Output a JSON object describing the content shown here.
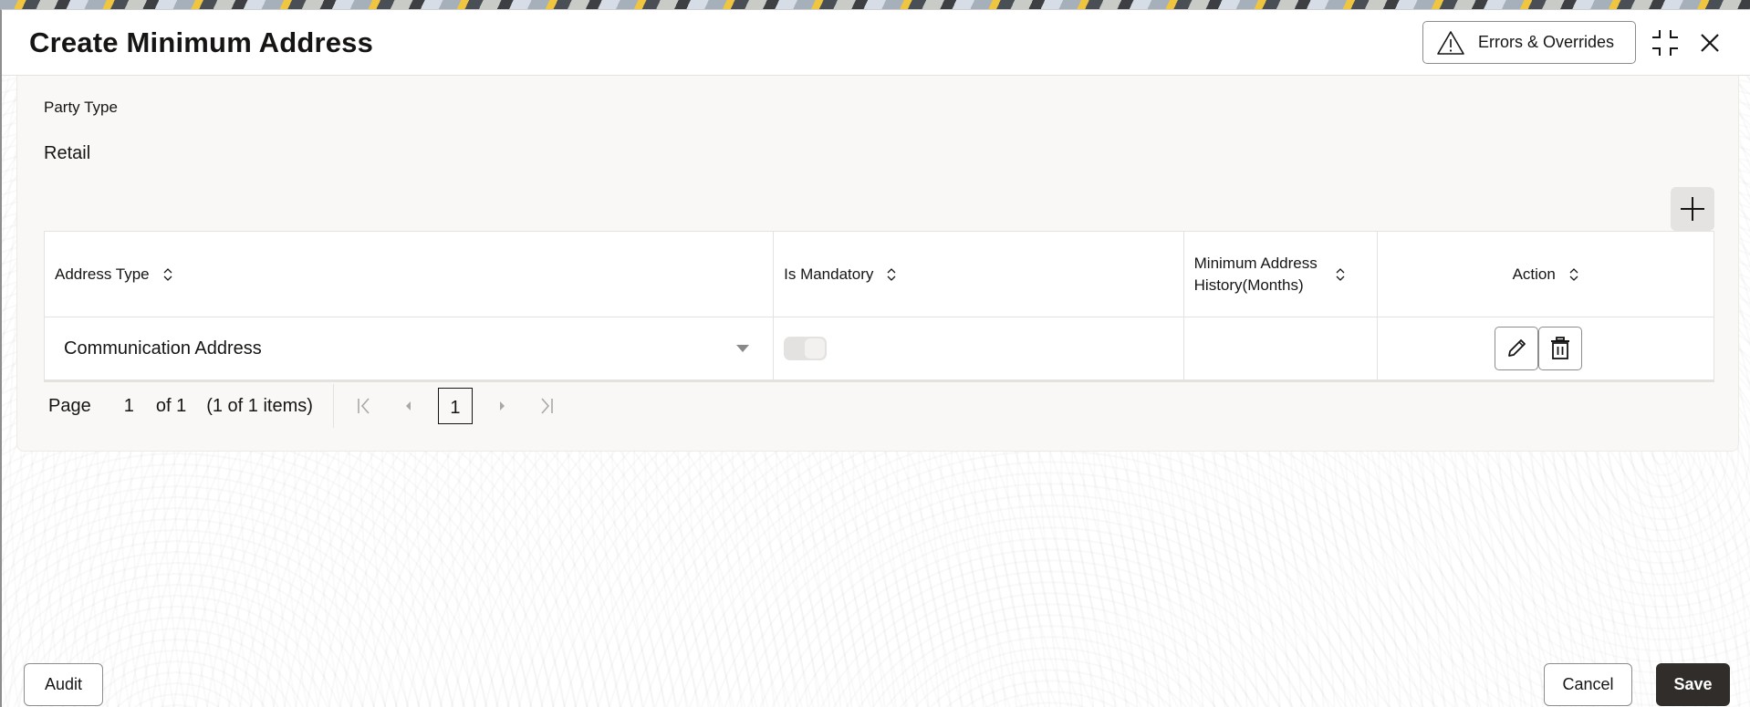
{
  "dialog": {
    "title": "Create Minimum Address",
    "errors_button_label": "Errors & Overrides",
    "icons": {
      "errors": "warning-triangle-icon",
      "compress": "compress-icon",
      "close": "close-icon"
    }
  },
  "form": {
    "party_type_label": "Party Type",
    "party_type_value": "Retail",
    "add_row_icon": "plus-icon"
  },
  "table": {
    "columns": [
      {
        "label": "Address Type",
        "sortable": true
      },
      {
        "label": "Is Mandatory",
        "sortable": true
      },
      {
        "label": "Minimum Address History(Months)",
        "sortable": true
      },
      {
        "label": "Action",
        "sortable": true
      }
    ],
    "rows": [
      {
        "address_type": "Communication Address",
        "is_mandatory": false,
        "min_history_months": "",
        "actions": [
          "edit",
          "delete"
        ]
      }
    ]
  },
  "pagination": {
    "page_label": "Page",
    "current_page": "1",
    "of_label": "of 1",
    "items_summary": "(1 of 1 items)",
    "page_buttons": [
      "1"
    ]
  },
  "footer": {
    "audit_label": "Audit",
    "cancel_label": "Cancel",
    "save_label": "Save"
  },
  "colors": {
    "primary_button": "#312d2a",
    "panel_background": "#f9f8f6",
    "text": "#161513"
  }
}
